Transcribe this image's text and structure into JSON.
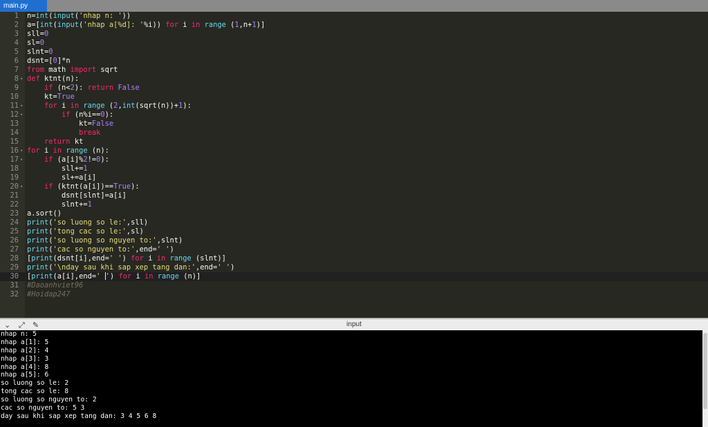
{
  "tab": {
    "label": "main.py"
  },
  "editor": {
    "active_line": 30,
    "fold_lines": [
      8,
      11,
      12,
      16,
      17,
      20
    ],
    "lines": [
      [
        [
          "n=",
          ""
        ],
        [
          "int",
          "b"
        ],
        [
          "(",
          ""
        ],
        [
          "input",
          "b"
        ],
        [
          "(",
          ""
        ],
        [
          "'nhap n: '",
          "s"
        ],
        [
          "))",
          ""
        ]
      ],
      [
        [
          "a=[",
          ""
        ],
        [
          "int",
          "b"
        ],
        [
          "(",
          ""
        ],
        [
          "input",
          "b"
        ],
        [
          "(",
          ""
        ],
        [
          "'nhap a[%d]: '",
          "s"
        ],
        [
          "%i)) ",
          ""
        ],
        [
          "for",
          "k"
        ],
        [
          " i ",
          ""
        ],
        [
          "in",
          "k"
        ],
        [
          " ",
          ""
        ],
        [
          "range",
          "b"
        ],
        [
          " (",
          ""
        ],
        [
          "1",
          "n"
        ],
        [
          ",n+",
          ""
        ],
        [
          "1",
          "n"
        ],
        [
          ")]",
          ""
        ]
      ],
      [
        [
          "sll=",
          ""
        ],
        [
          "0",
          "n"
        ]
      ],
      [
        [
          "sl=",
          ""
        ],
        [
          "0",
          "n"
        ]
      ],
      [
        [
          "slnt=",
          ""
        ],
        [
          "0",
          "n"
        ]
      ],
      [
        [
          "dsnt=[",
          ""
        ],
        [
          "0",
          "n"
        ],
        [
          "]*n",
          ""
        ]
      ],
      [
        [
          "from",
          "k"
        ],
        [
          " math ",
          ""
        ],
        [
          "import",
          "k"
        ],
        [
          " sqrt",
          ""
        ]
      ],
      [
        [
          "def",
          "k"
        ],
        [
          " ktnt(n):",
          ""
        ]
      ],
      [
        [
          "    ",
          ""
        ],
        [
          "if",
          "k"
        ],
        [
          " (n<",
          ""
        ],
        [
          "2",
          "n"
        ],
        [
          "): ",
          ""
        ],
        [
          "return",
          "k"
        ],
        [
          " ",
          ""
        ],
        [
          "False",
          "n"
        ]
      ],
      [
        [
          "    kt=",
          ""
        ],
        [
          "True",
          "n"
        ]
      ],
      [
        [
          "    ",
          ""
        ],
        [
          "for",
          "k"
        ],
        [
          " i ",
          ""
        ],
        [
          "in",
          "k"
        ],
        [
          " ",
          ""
        ],
        [
          "range",
          "b"
        ],
        [
          " (",
          ""
        ],
        [
          "2",
          "n"
        ],
        [
          ",",
          ""
        ],
        [
          "int",
          "b"
        ],
        [
          "(sqrt(n))+",
          ""
        ],
        [
          "1",
          "n"
        ],
        [
          "):",
          ""
        ]
      ],
      [
        [
          "        ",
          ""
        ],
        [
          "if",
          "k"
        ],
        [
          " (n%i==",
          ""
        ],
        [
          "0",
          "n"
        ],
        [
          "):",
          ""
        ]
      ],
      [
        [
          "            kt=",
          ""
        ],
        [
          "False",
          "n"
        ]
      ],
      [
        [
          "            ",
          ""
        ],
        [
          "break",
          "k"
        ]
      ],
      [
        [
          "    ",
          ""
        ],
        [
          "return",
          "k"
        ],
        [
          " kt",
          ""
        ]
      ],
      [
        [
          "for",
          "k"
        ],
        [
          " i ",
          ""
        ],
        [
          "in",
          "k"
        ],
        [
          " ",
          ""
        ],
        [
          "range",
          "b"
        ],
        [
          " (n):",
          ""
        ]
      ],
      [
        [
          "    ",
          ""
        ],
        [
          "if",
          "k"
        ],
        [
          " (a[i]%",
          ""
        ],
        [
          "2",
          "n"
        ],
        [
          "!=",
          ""
        ],
        [
          "0",
          "n"
        ],
        [
          "):",
          ""
        ]
      ],
      [
        [
          "        sll+=",
          ""
        ],
        [
          "1",
          "n"
        ]
      ],
      [
        [
          "        sl+=a[i]",
          ""
        ]
      ],
      [
        [
          "    ",
          ""
        ],
        [
          "if",
          "k"
        ],
        [
          " (ktnt(a[i])==",
          ""
        ],
        [
          "True",
          "n"
        ],
        [
          "):",
          ""
        ]
      ],
      [
        [
          "        dsnt[slnt]=a[i]",
          ""
        ]
      ],
      [
        [
          "        slnt+=",
          ""
        ],
        [
          "1",
          "n"
        ]
      ],
      [
        [
          "a.sort()",
          ""
        ]
      ],
      [
        [
          "print",
          "b"
        ],
        [
          "(",
          ""
        ],
        [
          "'so luong so le:'",
          "s"
        ],
        [
          ",sll)",
          ""
        ]
      ],
      [
        [
          "print",
          "b"
        ],
        [
          "(",
          ""
        ],
        [
          "'tong cac so le:'",
          "s"
        ],
        [
          ",sl)",
          ""
        ]
      ],
      [
        [
          "print",
          "b"
        ],
        [
          "(",
          ""
        ],
        [
          "'so luong so nguyen to:'",
          "s"
        ],
        [
          ",slnt)",
          ""
        ]
      ],
      [
        [
          "print",
          "b"
        ],
        [
          "(",
          ""
        ],
        [
          "'cac so nguyen to:'",
          "s"
        ],
        [
          ",end=",
          ""
        ],
        [
          "' '",
          "s"
        ],
        [
          ")",
          ""
        ]
      ],
      [
        [
          "[",
          ""
        ],
        [
          "print",
          "b"
        ],
        [
          "(dsnt[i],end=",
          ""
        ],
        [
          "' '",
          "s"
        ],
        [
          ") ",
          ""
        ],
        [
          "for",
          "k"
        ],
        [
          " i ",
          ""
        ],
        [
          "in",
          "k"
        ],
        [
          " ",
          ""
        ],
        [
          "range",
          "b"
        ],
        [
          " (slnt)]",
          ""
        ]
      ],
      [
        [
          "print",
          "b"
        ],
        [
          "(",
          ""
        ],
        [
          "'\\nday sau khi sap xep tang dan:'",
          "s"
        ],
        [
          ",end=",
          ""
        ],
        [
          "' '",
          "s"
        ],
        [
          ")",
          ""
        ]
      ],
      [
        [
          "[",
          ""
        ],
        [
          "print",
          "b"
        ],
        [
          "(a[i],end=",
          ""
        ],
        [
          "' ",
          "s"
        ],
        [
          "|cursor|",
          "cursor"
        ],
        [
          "'",
          "s"
        ],
        [
          ") ",
          ""
        ],
        [
          "for",
          "k"
        ],
        [
          " i ",
          ""
        ],
        [
          "in",
          "k"
        ],
        [
          " ",
          ""
        ],
        [
          "range",
          "b"
        ],
        [
          " (n)]",
          ""
        ]
      ],
      [
        [
          "#Daoanhviet96",
          "c"
        ]
      ],
      [
        [
          "#Hoidap247",
          "c"
        ]
      ]
    ]
  },
  "console": {
    "title": "input",
    "icons": [
      "chevron-down-icon",
      "expand-icon",
      "clear-icon"
    ],
    "output": [
      "nhap n: 5",
      "nhap a[1]: 5",
      "nhap a[2]: 4",
      "nhap a[3]: 3",
      "nhap a[4]: 8",
      "nhap a[5]: 6",
      "so luong so le: 2",
      "tong cac so le: 8",
      "so luong so nguyen to: 2",
      "cac so nguyen to: 5 3",
      "day sau khi sap xep tang dan: 3 4 5 6 8"
    ]
  }
}
